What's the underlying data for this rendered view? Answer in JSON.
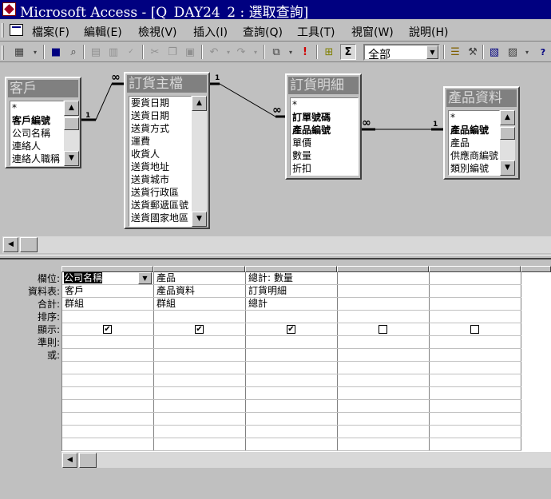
{
  "window": {
    "title": "Microsoft Access - [Q_DAY24_2 : 選取查詢]"
  },
  "menu": {
    "items": [
      "檔案(F)",
      "編輯(E)",
      "檢視(V)",
      "插入(I)",
      "查詢(Q)",
      "工具(T)",
      "視窗(W)",
      "說明(H)"
    ]
  },
  "toolbar": {
    "sigma_label": "Σ",
    "topvalues": "全部",
    "icons": [
      "view-icon",
      "save-icon",
      "print-preview-icon",
      "print-icon",
      "spelling-icon",
      "cut-icon",
      "copy-icon",
      "paste-icon",
      "undo-icon",
      "redo-icon",
      "query-type-icon",
      "run-icon",
      "show-table-icon",
      "totals-icon",
      "properties-icon",
      "build-icon",
      "database-window-icon",
      "new-object-icon",
      "help-icon"
    ]
  },
  "tables": [
    {
      "title": "客戶",
      "fields": [
        "*",
        "客戶編號",
        "公司名稱",
        "連絡人",
        "連絡人職稱"
      ],
      "bold": [
        1
      ]
    },
    {
      "title": "訂貨主檔",
      "fields": [
        "要貨日期",
        "送貨日期",
        "送貨方式",
        "運費",
        "收貨人",
        "送貨地址",
        "送貨城市",
        "送貨行政區",
        "送貨郵遞區號",
        "送貨國家地區"
      ],
      "bold": []
    },
    {
      "title": "訂貨明細",
      "fields": [
        "*",
        "訂單號碼",
        "產品編號",
        "單價",
        "數量",
        "折扣"
      ],
      "bold": [
        1,
        2
      ]
    },
    {
      "title": "產品資料",
      "fields": [
        "*",
        "產品編號",
        "產品",
        "供應商編號",
        "類別編號"
      ],
      "bold": [
        1
      ]
    }
  ],
  "relationships": {
    "one": "1",
    "many": "∞"
  },
  "grid": {
    "row_labels": [
      "欄位:",
      "資料表:",
      "合計:",
      "排序:",
      "顯示:",
      "準則:",
      "或:"
    ],
    "columns": [
      {
        "field": "公司名稱",
        "table": "客戶",
        "total": "群組",
        "sort": "",
        "show": true
      },
      {
        "field": "產品",
        "table": "產品資料",
        "total": "群組",
        "sort": "",
        "show": true
      },
      {
        "field": "總計: 數量",
        "table": "訂貨明細",
        "total": "總計",
        "sort": "",
        "show": true
      },
      {
        "field": "",
        "table": "",
        "total": "",
        "sort": "",
        "show": false
      },
      {
        "field": "",
        "table": "",
        "total": "",
        "sort": "",
        "show": false
      }
    ],
    "check_mark": "✔"
  }
}
